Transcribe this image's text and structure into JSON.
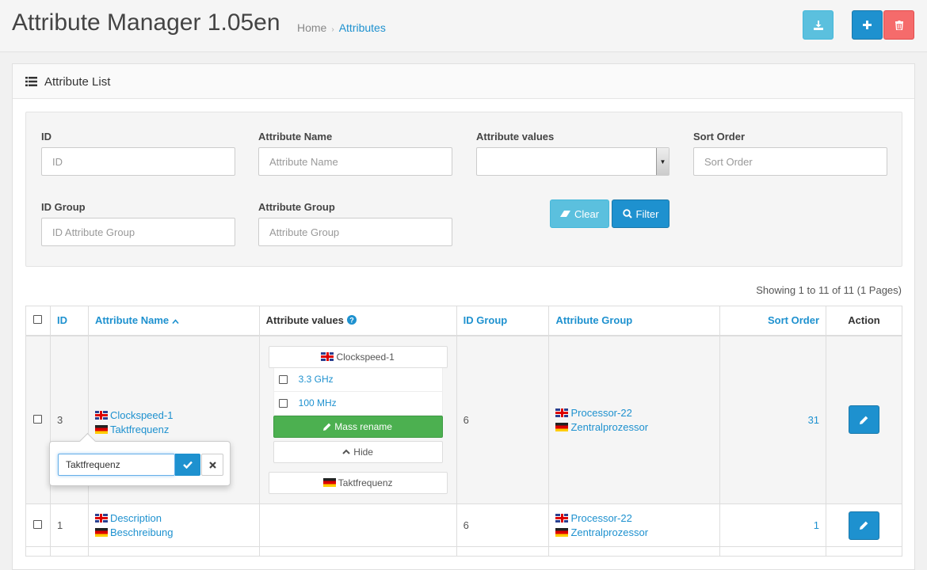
{
  "header": {
    "title": "Attribute Manager 1.05en",
    "breadcrumb": {
      "home": "Home",
      "current": "Attributes"
    },
    "buttons": {
      "download_icon": "download-icon",
      "add_icon": "plus-icon",
      "delete_icon": "trash-icon"
    }
  },
  "panel": {
    "title": "Attribute List",
    "icon": "list-icon"
  },
  "filter": {
    "id_label": "ID",
    "id_placeholder": "ID",
    "name_label": "Attribute Name",
    "name_placeholder": "Attribute Name",
    "values_label": "Attribute values",
    "sort_label": "Sort Order",
    "sort_placeholder": "Sort Order",
    "group_id_label": "ID Group",
    "group_id_placeholder": "ID Attribute Group",
    "group_label": "Attribute Group",
    "group_placeholder": "Attribute Group",
    "clear_label": "Clear",
    "filter_label": "Filter"
  },
  "pagination": {
    "showing": "Showing 1 to 11 of 11 (1 Pages)"
  },
  "table": {
    "headers": {
      "id": "ID",
      "name": "Attribute Name",
      "values": "Attribute values",
      "group_id": "ID Group",
      "group": "Attribute Group",
      "sort": "Sort Order",
      "action": "Action"
    },
    "rows": [
      {
        "id": "3",
        "name_en": "Clockspeed-1",
        "name_de": "Taktfrequenz",
        "values_head_en": "Clockspeed-1",
        "values": [
          "3.3 GHz",
          "100 MHz"
        ],
        "mass_rename": "Mass rename",
        "hide": "Hide",
        "values_head_de": "Taktfrequenz",
        "group_id": "6",
        "group_en": "Processor-22",
        "group_de": "Zentralprozessor",
        "sort": "31"
      },
      {
        "id": "1",
        "name_en": "Description",
        "name_de": "Beschreibung",
        "group_id": "6",
        "group_en": "Processor-22",
        "group_de": "Zentralprozessor",
        "sort": "1"
      }
    ]
  },
  "popup": {
    "value": "Taktfrequenz"
  },
  "colors": {
    "primary": "#1e91cf",
    "info": "#5bc0de",
    "danger": "#f56b6b",
    "success": "#4cb050"
  }
}
